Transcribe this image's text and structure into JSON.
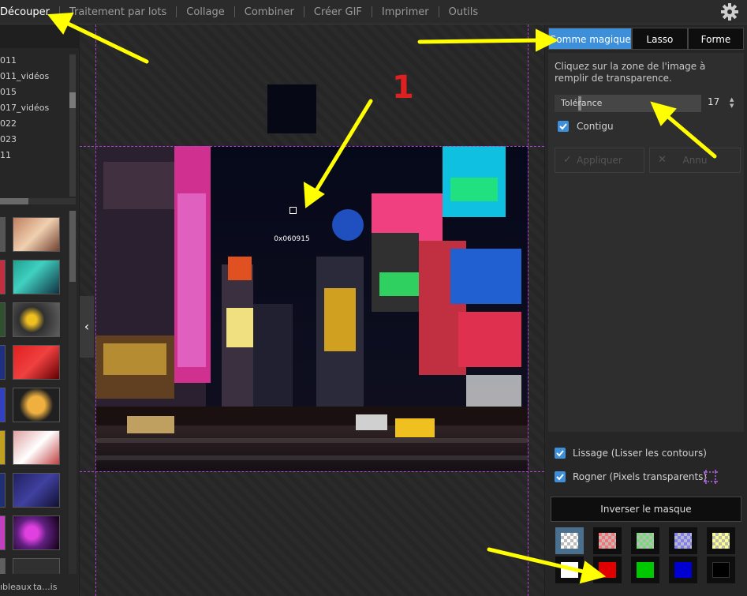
{
  "menu": {
    "items": [
      "Découper",
      "Traitement par lots",
      "Collage",
      "Combiner",
      "Créer GIF",
      "Imprimer",
      "Outils"
    ],
    "active": "Découper"
  },
  "left_panel": {
    "tree_items": [
      "011",
      "011_vidéos",
      "015",
      "017_vidéos",
      "022",
      "023",
      "11"
    ],
    "bottom_tabs": [
      "ıbleaux",
      "ta...is"
    ]
  },
  "canvas": {
    "pixel_hex": "0x060915",
    "sample_color": "#060915"
  },
  "right_panel": {
    "tabs": [
      "Gomme magique",
      "Lasso",
      "Forme"
    ],
    "active_tab": "Gomme magique",
    "instruction": "Cliquez sur la zone de l'image à remplir de transparence.",
    "tolerance_label": "Tolérance",
    "tolerance_value": "17",
    "contigu_label": "Contigu",
    "apply_label": "Appliquer",
    "cancel_label": "Annu",
    "smoothing_label": "Lissage (Lisser les contours)",
    "crop_label": "Rogner (Pixels transparents)",
    "invert_label": "Inverser le masque",
    "swatches_row1": [
      "checker",
      "#ff6f6f",
      "#6fe06f",
      "#7f7fff",
      "#ffff80"
    ],
    "swatches_row2": [
      "#ffffff",
      "#e00000",
      "#00c800",
      "#0000d0",
      "#000000"
    ]
  },
  "annotation": {
    "number": "1",
    "arrow_color": "#ffff00"
  }
}
